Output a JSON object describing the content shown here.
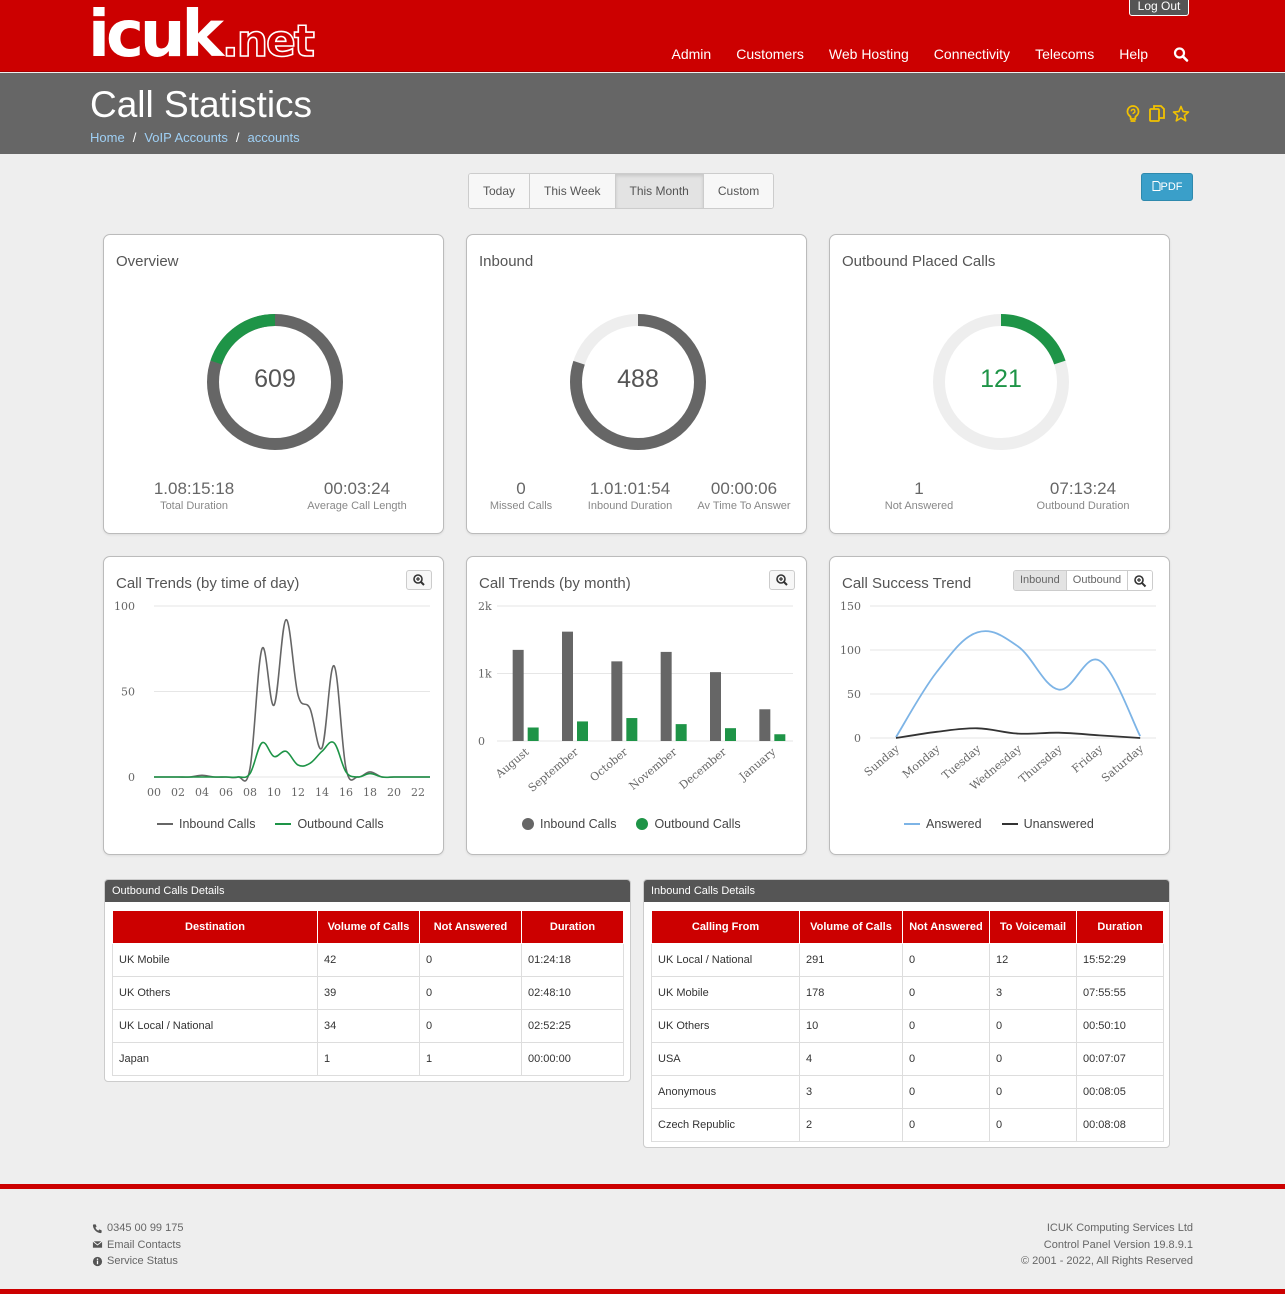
{
  "brand": {
    "logo_main": "icuk",
    "logo_ext": ".net"
  },
  "top": {
    "logout": "Log Out",
    "nav": [
      "Admin",
      "Customers",
      "Web Hosting",
      "Connectivity",
      "Telecoms",
      "Help"
    ]
  },
  "header": {
    "title": "Call Statistics",
    "breadcrumb": [
      "Home",
      "VoIP Accounts",
      "accounts"
    ]
  },
  "range": {
    "buttons": [
      "Today",
      "This Week",
      "This Month",
      "Custom"
    ],
    "active": "This Month",
    "pdf": "PDF"
  },
  "colors": {
    "brand_red": "#cc0000",
    "grey": "#666666",
    "green": "#1e9447",
    "blue": "#7db4e6",
    "light": "#eeeeee"
  },
  "overview": {
    "title": "Overview",
    "total": "609",
    "green_fraction": 0.199,
    "stats": [
      {
        "value": "1.08:15:18",
        "label": "Total Duration"
      },
      {
        "value": "00:03:24",
        "label": "Average Call Length"
      }
    ]
  },
  "inbound": {
    "title": "Inbound",
    "total": "488",
    "grey_fraction": 0.8,
    "stats": [
      {
        "value": "0",
        "label": "Missed Calls"
      },
      {
        "value": "1.01:01:54",
        "label": "Inbound Duration"
      },
      {
        "value": "00:00:06",
        "label": "Av Time To Answer"
      }
    ]
  },
  "outbound": {
    "title": "Outbound Placed Calls",
    "total": "121",
    "green_fraction": 0.199,
    "stats": [
      {
        "value": "1",
        "label": "Not Answered"
      },
      {
        "value": "07:13:24",
        "label": "Outbound Duration"
      }
    ]
  },
  "trends_day": {
    "title": "Call Trends (by time of day)",
    "legend": [
      "Inbound Calls",
      "Outbound Calls"
    ]
  },
  "trends_month": {
    "title": "Call Trends (by month)",
    "legend": [
      "Inbound Calls",
      "Outbound Calls"
    ]
  },
  "success": {
    "title": "Call Success Trend",
    "toggles": [
      "Inbound",
      "Outbound"
    ],
    "legend": [
      "Answered",
      "Unanswered"
    ]
  },
  "chart_data": [
    {
      "type": "line",
      "title": "Call Trends (by time of day)",
      "x": [
        0,
        1,
        2,
        3,
        4,
        5,
        6,
        7,
        8,
        9,
        10,
        11,
        12,
        13,
        14,
        15,
        16,
        17,
        18,
        19,
        20,
        21,
        22,
        23
      ],
      "x_ticks": [
        "00",
        "02",
        "04",
        "06",
        "08",
        "10",
        "12",
        "14",
        "16",
        "18",
        "20",
        "22"
      ],
      "ylim": [
        0,
        100
      ],
      "y_ticks": [
        "100",
        "50",
        "0"
      ],
      "series": [
        {
          "name": "Inbound Calls",
          "color": "#666666",
          "values": [
            0,
            0,
            0,
            0,
            1,
            0,
            0,
            0,
            5,
            75,
            42,
            92,
            48,
            40,
            17,
            65,
            5,
            0,
            3,
            0,
            0,
            0,
            0,
            0
          ]
        },
        {
          "name": "Outbound Calls",
          "color": "#1e9447",
          "values": [
            0,
            0,
            0,
            0,
            0,
            0,
            0,
            0,
            2,
            20,
            12,
            15,
            7,
            8,
            15,
            20,
            3,
            0,
            2,
            0,
            0,
            0,
            0,
            0
          ]
        }
      ],
      "legend": "bottom"
    },
    {
      "type": "bar",
      "title": "Call Trends (by month)",
      "categories": [
        "August",
        "September",
        "October",
        "November",
        "December",
        "January"
      ],
      "ylim": [
        0,
        2000
      ],
      "y_ticks": [
        "2k",
        "1k",
        "0"
      ],
      "series": [
        {
          "name": "Inbound Calls",
          "color": "#666666",
          "values": [
            1350,
            1620,
            1180,
            1320,
            1020,
            470
          ]
        },
        {
          "name": "Outbound Calls",
          "color": "#1e9447",
          "values": [
            200,
            290,
            340,
            250,
            190,
            100
          ]
        }
      ],
      "legend": "bottom"
    },
    {
      "type": "line",
      "title": "Call Success Trend",
      "categories": [
        "Sunday",
        "Monday",
        "Tuesday",
        "Wednesday",
        "Thursday",
        "Friday",
        "Saturday"
      ],
      "ylim": [
        0,
        150
      ],
      "y_ticks": [
        "150",
        "100",
        "50",
        "0"
      ],
      "series": [
        {
          "name": "Answered",
          "color": "#7db4e6",
          "values": [
            1,
            75,
            120,
            104,
            55,
            88,
            2
          ]
        },
        {
          "name": "Unanswered",
          "color": "#333333",
          "values": [
            0,
            7,
            11,
            5,
            6,
            3,
            0
          ]
        }
      ],
      "legend": "bottom"
    }
  ],
  "outbound_table": {
    "title": "Outbound Calls Details",
    "columns": [
      "Destination",
      "Volume of Calls",
      "Not Answered",
      "Duration"
    ],
    "rows": [
      [
        "UK Mobile",
        "42",
        "0",
        "01:24:18"
      ],
      [
        "UK Others",
        "39",
        "0",
        "02:48:10"
      ],
      [
        "UK Local / National",
        "34",
        "0",
        "02:52:25"
      ],
      [
        "Japan",
        "1",
        "1",
        "00:00:00"
      ]
    ]
  },
  "inbound_table": {
    "title": "Inbound Calls Details",
    "columns": [
      "Calling From",
      "Volume of Calls",
      "Not Answered",
      "To Voicemail",
      "Duration"
    ],
    "rows": [
      [
        "UK Local / National",
        "291",
        "0",
        "12",
        "15:52:29"
      ],
      [
        "UK Mobile",
        "178",
        "0",
        "3",
        "07:55:55"
      ],
      [
        "UK Others",
        "10",
        "0",
        "0",
        "00:50:10"
      ],
      [
        "USA",
        "4",
        "0",
        "0",
        "00:07:07"
      ],
      [
        "Anonymous",
        "3",
        "0",
        "0",
        "00:08:05"
      ],
      [
        "Czech Republic",
        "2",
        "0",
        "0",
        "00:08:08"
      ]
    ]
  },
  "footer": {
    "phone": "0345 00 99 175",
    "email": "Email Contacts",
    "status": "Service Status",
    "company": "ICUK Computing Services Ltd",
    "version": "Control Panel Version 19.8.9.1",
    "copyright": "© 2001 - 2022, All Rights Reserved"
  }
}
